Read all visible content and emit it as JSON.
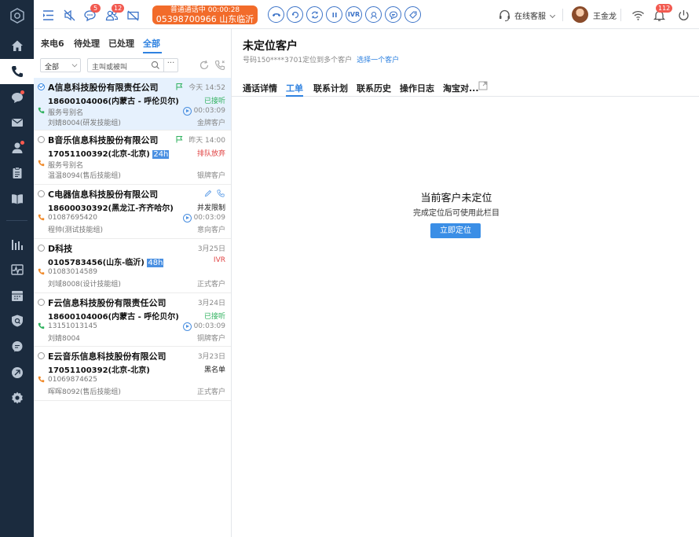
{
  "topbar": {
    "badges": {
      "messages": "5",
      "contacts": "12",
      "alerts": "112"
    },
    "call": {
      "status": "普通通话中",
      "timer": "00:00:28",
      "number": "05398700966",
      "location": "山东临沂"
    },
    "ivr_label": "IVR",
    "service_status": "在线客服",
    "user_name": "王金龙"
  },
  "list": {
    "tabs": [
      {
        "label": "来电6"
      },
      {
        "label": "待处理"
      },
      {
        "label": "已处理"
      },
      {
        "label": "全部"
      }
    ],
    "filter": {
      "scope": "全部",
      "search_placeholder": "主叫或被叫",
      "more": "···"
    },
    "items": [
      {
        "title": "A信息科技股份有限责任公司",
        "time": "今天 14:52",
        "number": "18600104006(内蒙古 - 呼伦贝尔)",
        "tag": "",
        "status": "已接听",
        "sub": "服务号别名",
        "duration": "00:03:09",
        "agent": "刘婧8004(研发技能组)",
        "level": "金牌客户"
      },
      {
        "title": "B音乐信息科技股份有限公司",
        "time": "昨天 14:00",
        "number": "17051100392(北京-北京)",
        "tag": "24h",
        "status": "排队放弃",
        "sub": "服务号别名",
        "duration": "",
        "agent": "温温8094(售后技能组)",
        "level": "银牌客户"
      },
      {
        "title": "C电器信息科技股份有限公司",
        "time": "",
        "number": "18600030392(黑龙江-齐齐哈尔)",
        "tag": "",
        "status": "并发限制",
        "sub": "01087695420",
        "duration": "00:03:09",
        "agent": "程帅(测试技能组)",
        "level": "意向客户"
      },
      {
        "title": "D科技",
        "time": "3月25日",
        "number": "0105783456(山东-临沂)",
        "tag": "48h",
        "status": "IVR",
        "sub": "01083014589",
        "duration": "",
        "agent": "刘域8008(设计技能组)",
        "level": "正式客户"
      },
      {
        "title": "F云信息科技股份有限责任公司",
        "time": "3月24日",
        "number": "18600104006(内蒙古 - 呼伦贝尔)",
        "tag": "",
        "status": "已接听",
        "sub": "13151013145",
        "duration": "00:03:09",
        "agent": "刘婧8004",
        "level": "铜牌客户"
      },
      {
        "title": "E云音乐信息科技股份有限公司",
        "time": "3月23日",
        "number": "17051100392(北京-北京)",
        "tag": "",
        "status": "黑名单",
        "sub": "01069874625",
        "duration": "",
        "agent": "晖晖8092(售后技能组)",
        "level": "正式客户"
      }
    ]
  },
  "detail": {
    "title": "未定位客户",
    "subtitle": "号码150****3701定位到多个客户",
    "subtitle_link": "选择一个客户",
    "tabs": [
      {
        "label": "通话详情"
      },
      {
        "label": "工单"
      },
      {
        "label": "联系计划"
      },
      {
        "label": "联系历史"
      },
      {
        "label": "操作日志"
      },
      {
        "label": "淘宝对..."
      }
    ],
    "empty_title": "当前客户未定位",
    "empty_sub": "完成定位后可使用此栏目",
    "locate_button": "立即定位"
  },
  "colors": {
    "accent": "#2f82e0",
    "nav_bg": "#1b2b3e",
    "call_pill": "#f26b2a",
    "badge": "#f25a50",
    "green": "#2fb15e",
    "red": "#e04343"
  },
  "icons": [
    "app-logo-icon",
    "home-icon",
    "phone-icon",
    "chat-icon",
    "mail-icon",
    "user-icon",
    "clipboard-icon",
    "book-icon",
    "bar-chart-icon",
    "pulse-icon",
    "calendar-icon",
    "shield-icon",
    "bubble-icon",
    "link-icon",
    "settings-icon",
    "menu-collapse-icon",
    "mute-icon",
    "message-icon",
    "contacts-icon",
    "video-off-icon",
    "hangup-icon",
    "hold-icon",
    "transfer-icon",
    "pause-icon",
    "ivr-icon",
    "consult-icon",
    "satisfaction-icon",
    "tag-icon",
    "headset-icon",
    "wifi-icon",
    "bell-icon",
    "power-icon",
    "search-icon",
    "refresh-icon",
    "dial-icon",
    "flag-icon",
    "play-icon",
    "edit-icon",
    "expand-icon"
  ]
}
